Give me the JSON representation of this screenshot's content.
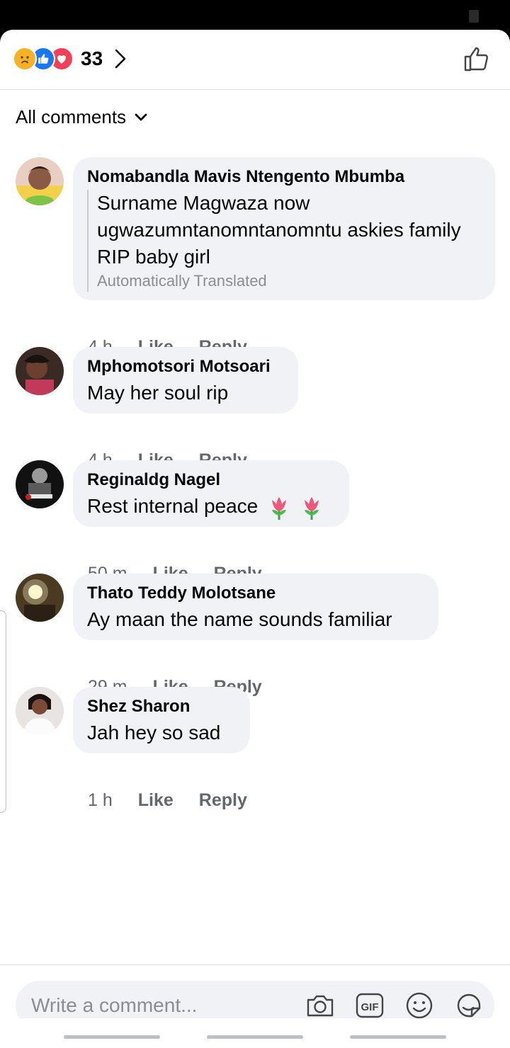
{
  "header": {
    "reaction_count": "33",
    "reactions": [
      "sad-reaction",
      "like-reaction",
      "love-reaction"
    ]
  },
  "filter": {
    "label": "All comments"
  },
  "comments": [
    {
      "author": "Nomabandla Mavis Ntengento Mbumba",
      "text": "Surname Magwaza now ugwazumntanomntanomntu askies family RIP baby girl",
      "note": "Automatically Translated",
      "time": "4 h",
      "like": "Like",
      "reply": "Reply"
    },
    {
      "author": "Mphomotsori Motsoari",
      "text": "May her soul rip",
      "time": "4 h",
      "like": "Like",
      "reply": "Reply"
    },
    {
      "author": "Reginaldg Nagel",
      "text": "Rest internal peace",
      "time": "50 m",
      "like": "Like",
      "reply": "Reply"
    },
    {
      "author": "Thato Teddy Molotsane",
      "text": "Ay maan the name sounds familiar",
      "time": "29 m",
      "like": "Like",
      "reply": "Reply"
    },
    {
      "author": "Shez Sharon",
      "text": "Jah hey so sad",
      "time": "1 h",
      "like": "Like",
      "reply": "Reply"
    }
  ],
  "composer": {
    "placeholder": "Write a comment...",
    "icons": [
      "camera-icon",
      "gif-icon",
      "emoji-icon",
      "sticker-icon"
    ]
  },
  "colors": {
    "bubble": "#f0f2f5",
    "secondary_text": "#65676b",
    "like_blue": "#1877f2",
    "love_red": "#f33e58",
    "sad_yellow": "#f7b125"
  }
}
